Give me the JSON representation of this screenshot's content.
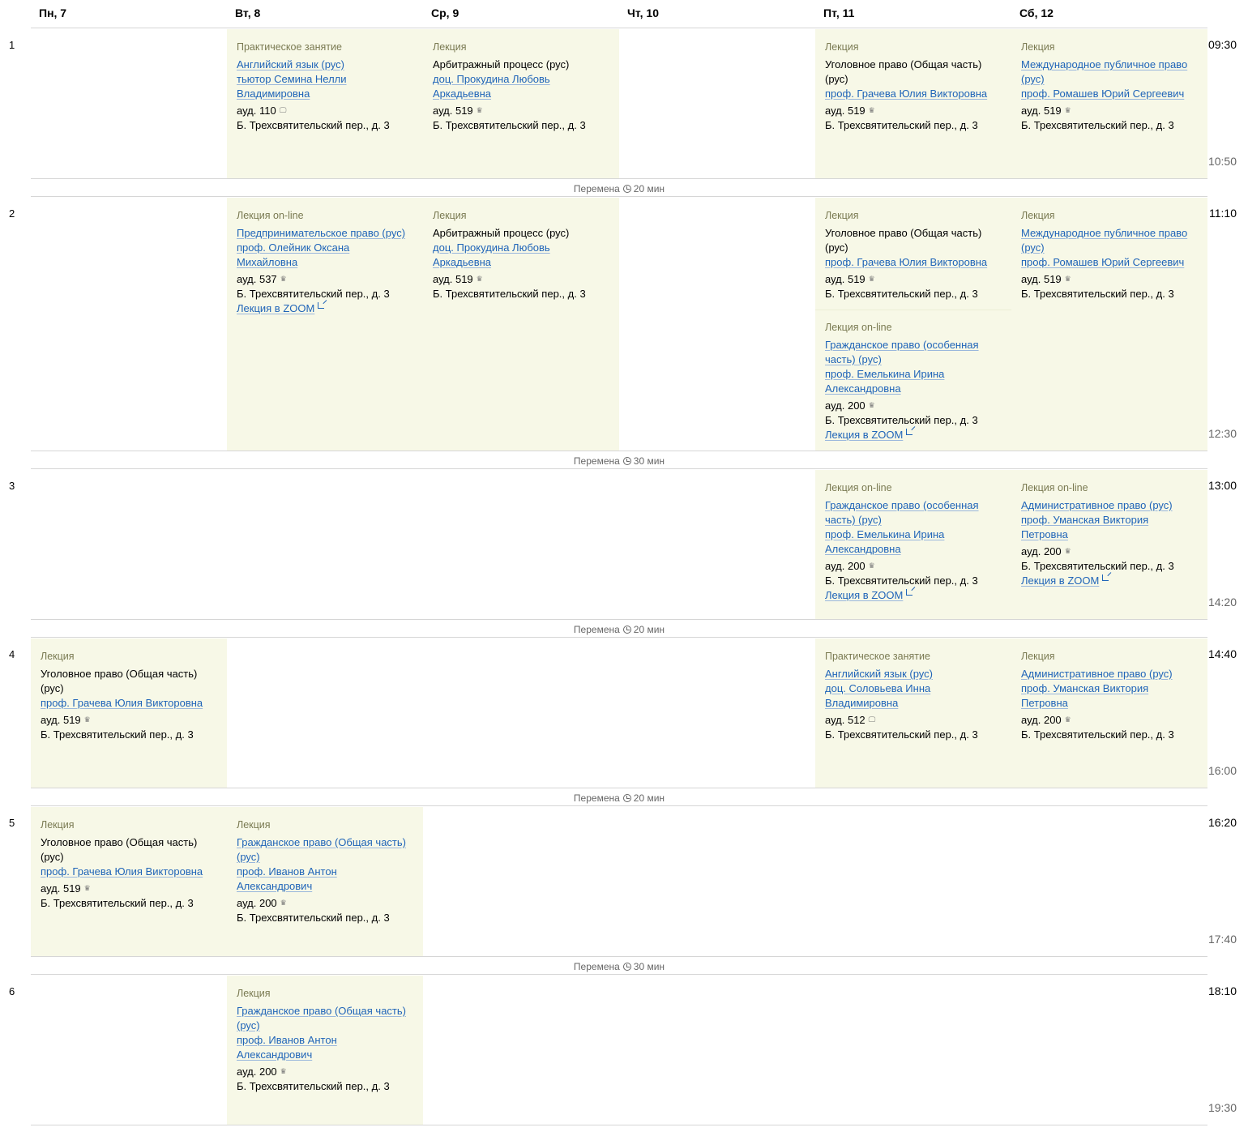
{
  "days": [
    "Пн, 7",
    "Вт, 8",
    "Ср, 9",
    "Чт, 10",
    "Пт, 11",
    "Сб, 12"
  ],
  "pairs": [
    {
      "num": "1",
      "start": "09:30",
      "end": "10:50"
    },
    {
      "num": "2",
      "start": "11:10",
      "end": "12:30"
    },
    {
      "num": "3",
      "start": "13:00",
      "end": "14:20"
    },
    {
      "num": "4",
      "start": "14:40",
      "end": "16:00"
    },
    {
      "num": "5",
      "start": "16:20",
      "end": "17:40"
    },
    {
      "num": "6",
      "start": "18:10",
      "end": "19:30"
    }
  ],
  "breaks": [
    {
      "label": "Перемена",
      "duration": "20 мин"
    },
    {
      "label": "Перемена",
      "duration": "30 мин"
    },
    {
      "label": "Перемена",
      "duration": "20 мин"
    },
    {
      "label": "Перемена",
      "duration": "20 мин"
    },
    {
      "label": "Перемена",
      "duration": "30 мин"
    }
  ],
  "lessons": {
    "p1_tue": {
      "type": "Практическое занятие",
      "subject": "Английский язык (рус)",
      "teacher_l1": "тьютор Семина Нелли",
      "teacher_l2": "Владимировна",
      "room": "ауд. 110",
      "room_icon": "computer-icon",
      "address": "Б. Трехсвятительский пер., д. 3"
    },
    "p1_wed": {
      "type": "Лекция",
      "subject": "Арбитражный процесс (рус)",
      "teacher_l1": "доц. Прокудина Любовь",
      "teacher_l2": "Аркадьевна",
      "room": "ауд. 519",
      "room_icon": "lecture-hall-icon",
      "address": "Б. Трехсвятительский пер., д. 3"
    },
    "p1_fri": {
      "type": "Лекция",
      "subject_l1": "Уголовное право (Общая часть)",
      "subject_l2": "(рус)",
      "teacher": "проф. Грачева Юлия Викторовна",
      "room": "ауд. 519",
      "room_icon": "lecture-hall-icon",
      "address": "Б. Трехсвятительский пер., д. 3"
    },
    "p1_sat": {
      "type": "Лекция",
      "subject_l1": "Международное публичное право",
      "subject_l2": "(рус)",
      "teacher": "проф. Ромашев Юрий Сергеевич",
      "room": "ауд. 519",
      "room_icon": "lecture-hall-icon",
      "address": "Б. Трехсвятительский пер., д. 3"
    },
    "p2_tue": {
      "type": "Лекция on-line",
      "subject": "Предпринимательское право (рус)",
      "teacher_l1": "проф. Олейник Оксана",
      "teacher_l2": "Михайловна",
      "room": "ауд. 537",
      "room_icon": "lecture-hall-icon",
      "address": "Б. Трехсвятительский пер., д. 3",
      "zoom": "Лекция в ZOOM"
    },
    "p2_wed": {
      "type": "Лекция",
      "subject": "Арбитражный процесс (рус)",
      "teacher_l1": "доц. Прокудина Любовь",
      "teacher_l2": "Аркадьевна",
      "room": "ауд. 519",
      "room_icon": "lecture-hall-icon",
      "address": "Б. Трехсвятительский пер., д. 3"
    },
    "p2_fri_a": {
      "type": "Лекция",
      "subject_l1": "Уголовное право (Общая часть)",
      "subject_l2": "(рус)",
      "teacher": "проф. Грачева Юлия Викторовна",
      "room": "ауд. 519",
      "room_icon": "lecture-hall-icon",
      "address": "Б. Трехсвятительский пер., д. 3"
    },
    "p2_fri_b": {
      "type": "Лекция on-line",
      "subject_l1": "Гражданское право (особенная",
      "subject_l2": "часть) (рус)",
      "teacher_l1": "проф. Емелькина Ирина",
      "teacher_l2": "Александровна",
      "room": "ауд. 200",
      "room_icon": "lecture-hall-icon",
      "address": "Б. Трехсвятительский пер., д. 3",
      "zoom": "Лекция в ZOOM"
    },
    "p2_sat": {
      "type": "Лекция",
      "subject_l1": "Международное публичное право",
      "subject_l2": "(рус)",
      "teacher": "проф. Ромашев Юрий Сергеевич",
      "room": "ауд. 519",
      "room_icon": "lecture-hall-icon",
      "address": "Б. Трехсвятительский пер., д. 3"
    },
    "p3_fri": {
      "type": "Лекция on-line",
      "subject_l1": "Гражданское право (особенная",
      "subject_l2": "часть) (рус)",
      "teacher_l1": "проф. Емелькина Ирина",
      "teacher_l2": "Александровна",
      "room": "ауд. 200",
      "room_icon": "lecture-hall-icon",
      "address": "Б. Трехсвятительский пер., д. 3",
      "zoom": "Лекция в ZOOM"
    },
    "p3_sat": {
      "type": "Лекция on-line",
      "subject": "Административное право (рус)",
      "teacher_l1": "проф. Уманская Виктория",
      "teacher_l2": "Петровна",
      "room": "ауд. 200",
      "room_icon": "lecture-hall-icon",
      "address": "Б. Трехсвятительский пер., д. 3",
      "zoom": "Лекция в ZOOM"
    },
    "p4_mon": {
      "type": "Лекция",
      "subject_l1": "Уголовное право (Общая часть)",
      "subject_l2": "(рус)",
      "teacher": "проф. Грачева Юлия Викторовна",
      "room": "ауд. 519",
      "room_icon": "lecture-hall-icon",
      "address": "Б. Трехсвятительский пер., д. 3"
    },
    "p4_fri": {
      "type": "Практическое занятие",
      "subject": "Английский язык (рус)",
      "teacher_l1": "доц. Соловьева Инна",
      "teacher_l2": "Владимировна",
      "room": "ауд. 512",
      "room_icon": "computer-icon",
      "address": "Б. Трехсвятительский пер., д. 3"
    },
    "p4_sat": {
      "type": "Лекция",
      "subject": "Административное право (рус)",
      "teacher_l1": "проф. Уманская Виктория",
      "teacher_l2": "Петровна",
      "room": "ауд. 200",
      "room_icon": "lecture-hall-icon",
      "address": "Б. Трехсвятительский пер., д. 3"
    },
    "p5_mon": {
      "type": "Лекция",
      "subject_l1": "Уголовное право (Общая часть)",
      "subject_l2": "(рус)",
      "teacher": "проф. Грачева Юлия Викторовна",
      "room": "ауд. 519",
      "room_icon": "lecture-hall-icon",
      "address": "Б. Трехсвятительский пер., д. 3"
    },
    "p5_tue": {
      "type": "Лекция",
      "subject_l1": "Гражданское право (Общая часть)",
      "subject_l2": "(рус)",
      "teacher_l1": "проф. Иванов Антон",
      "teacher_l2": "Александрович",
      "room": "ауд. 200",
      "room_icon": "lecture-hall-icon",
      "address": "Б. Трехсвятительский пер., д. 3"
    },
    "p6_tue": {
      "type": "Лекция",
      "subject_l1": "Гражданское право (Общая часть)",
      "subject_l2": "(рус)",
      "teacher_l1": "проф. Иванов Антон",
      "teacher_l2": "Александрович",
      "room": "ауд. 200",
      "room_icon": "lecture-hall-icon",
      "address": "Б. Трехсвятительский пер., д. 3"
    }
  },
  "colors": {
    "cell_bg": "#f7f8e7",
    "link": "#1f64b8",
    "type_label": "#7a7a52"
  }
}
